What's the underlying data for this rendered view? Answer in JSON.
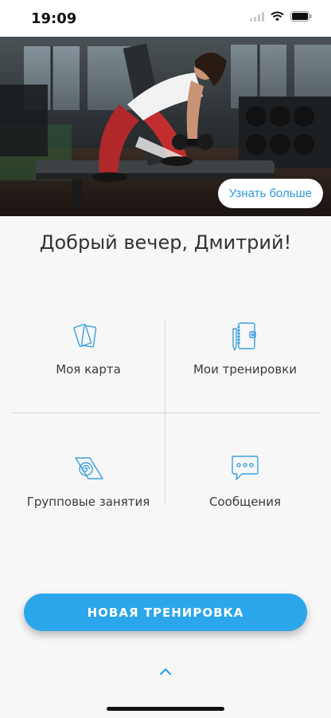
{
  "status_bar": {
    "time": "19:09",
    "icons": [
      "signal-icon",
      "wifi-icon",
      "battery-icon"
    ]
  },
  "hero": {
    "image": "gym-photo",
    "learn_more_label": "Узнать больше"
  },
  "greeting": "Добрый вечер, Дмитрий!",
  "menu": {
    "items": [
      {
        "label": "Моя карта",
        "icon": "cards-icon"
      },
      {
        "label": "Мои тренировки",
        "icon": "notebook-icon"
      },
      {
        "label": "Групповые занятия",
        "icon": "yoga-mat-icon"
      },
      {
        "label": "Сообщения",
        "icon": "chat-bubble-icon"
      }
    ]
  },
  "primary_action": {
    "label": "НОВАЯ ТРЕНИРОВКА"
  },
  "colors": {
    "accent": "#2ca6ea",
    "link": "#2a9ad8",
    "icon": "#3aa0dc",
    "background": "#f7f7f7"
  }
}
